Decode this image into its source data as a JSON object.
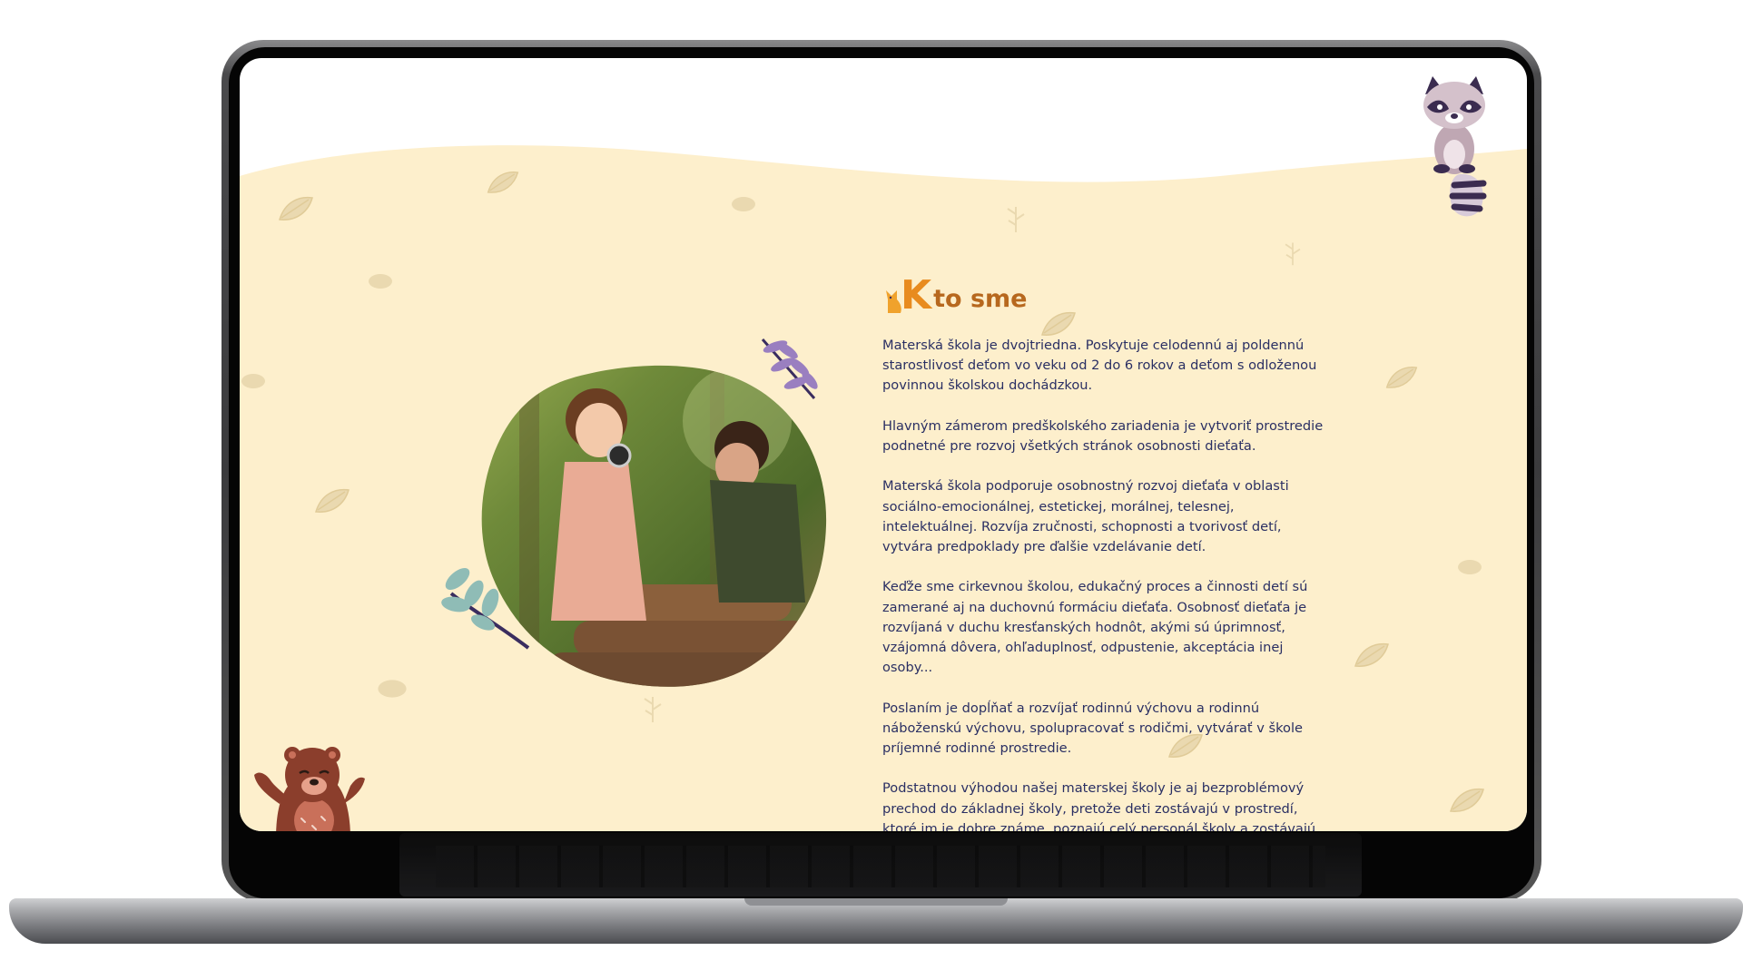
{
  "section": {
    "heading_initial": "K",
    "heading_rest": "to sme",
    "paragraphs": [
      "Materská škola je dvojtriedna. Poskytuje celodennú aj poldennú starostlivosť deťom vo veku od 2 do 6 rokov a deťom s odloženou povinnou školskou dochádzkou.",
      "Hlavným zámerom predškolského zariadenia je vytvoriť prostredie podnetné pre rozvoj všetkých stránok osobnosti dieťaťa.",
      "Materská škola podporuje osobnostný rozvoj dieťaťa v oblasti sociálno-emocionálnej, estetickej, morálnej, telesnej, intelektuálnej. Rozvíja zručnosti, schopnosti a tvorivosť detí, vytvára predpoklady pre ďalšie vzdelávanie detí.",
      "Keďže sme cirkevnou školou, edukačný proces a činnosti detí sú zamerané aj na duchovnú formáciu dieťaťa. Osobnosť dieťaťa je rozvíjaná v duchu kresťanských hodnôt, akými sú úprimnosť, vzájomná dôvera, ohľaduplnosť, odpustenie, akceptácia inej osoby...",
      "Poslaním je dopĺňať a rozvíjať rodinnú výchovu a rodinnú náboženskú výchovu, spolupracovať s rodičmi, vytvárať v škole príjemné rodinné prostredie.",
      "Podstatnou výhodou našej materskej školy je aj bezproblémový prechod do základnej školy, pretože deti zostávajú v prostredí, ktoré im je dobre známe, poznajú celý personál školy a zostávajú v"
    ]
  },
  "colors": {
    "cream": "#fdefcc",
    "heading_orange": "#e88b1f",
    "heading_brown": "#b7681e",
    "text_navy": "#2a2f63",
    "leaf_watermark": "#ead9b0",
    "leaf_purple": "#9a7fc0",
    "leaf_teal": "#8fbcb6"
  },
  "illustrations": [
    "raccoon-illustration",
    "bear-illustration",
    "leaf-pattern",
    "children-photo"
  ]
}
